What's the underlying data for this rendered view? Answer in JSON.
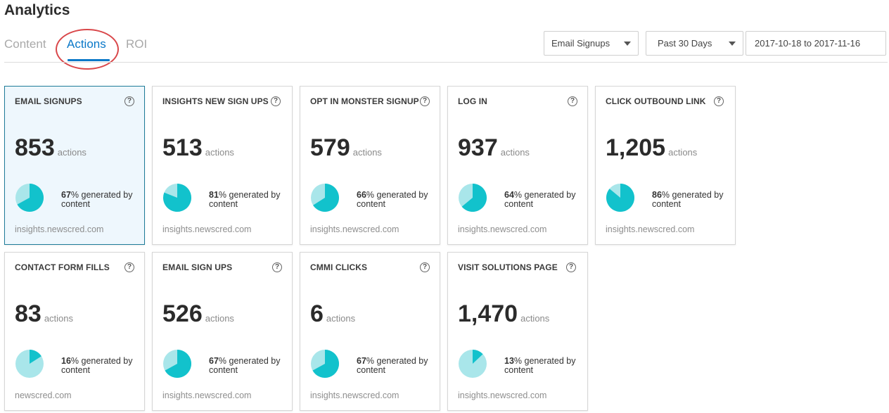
{
  "page_title": "Analytics",
  "tabs": [
    {
      "label": "Content",
      "active": false
    },
    {
      "label": "Actions",
      "active": true
    },
    {
      "label": "ROI",
      "active": false
    }
  ],
  "filters": {
    "action_select": "Email Signups",
    "range_select": "Past 30 Days",
    "date_range": "2017-10-18 to 2017-11-16"
  },
  "colors": {
    "accent_blue": "#0a78c8",
    "pie_primary": "#12c2cc",
    "pie_secondary": "#a9e6ea",
    "annotation_red": "#d9474a"
  },
  "cards": [
    {
      "title": "EMAIL SIGNUPS",
      "value": "853",
      "unit": "actions",
      "pct": "67",
      "pct_text": "% generated by content",
      "pct_fraction": 0.67,
      "domain": "insights.newscred.com",
      "active": true
    },
    {
      "title": "INSIGHTS NEW SIGN UPS",
      "value": "513",
      "unit": "actions",
      "pct": "81",
      "pct_text": "% generated by content",
      "pct_fraction": 0.81,
      "domain": "insights.newscred.com",
      "active": false
    },
    {
      "title": "OPT IN MONSTER SIGNUP",
      "value": "579",
      "unit": "actions",
      "pct": "66",
      "pct_text": "% generated by content",
      "pct_fraction": 0.66,
      "domain": "insights.newscred.com",
      "active": false
    },
    {
      "title": "LOG IN",
      "value": "937",
      "unit": "actions",
      "pct": "64",
      "pct_text": "% generated by content",
      "pct_fraction": 0.64,
      "domain": "insights.newscred.com",
      "active": false
    },
    {
      "title": "CLICK OUTBOUND LINK",
      "value": "1,205",
      "unit": "actions",
      "pct": "86",
      "pct_text": "% generated by content",
      "pct_fraction": 0.86,
      "domain": "insights.newscred.com",
      "active": false
    },
    {
      "title": "CONTACT FORM FILLS",
      "value": "83",
      "unit": "actions",
      "pct": "16",
      "pct_text": "% generated by content",
      "pct_fraction": 0.16,
      "domain": "newscred.com",
      "active": false
    },
    {
      "title": "EMAIL SIGN UPS",
      "value": "526",
      "unit": "actions",
      "pct": "67",
      "pct_text": "% generated by content",
      "pct_fraction": 0.67,
      "domain": "insights.newscred.com",
      "active": false
    },
    {
      "title": "CMMI CLICKS",
      "value": "6",
      "unit": "actions",
      "pct": "67",
      "pct_text": "% generated by content",
      "pct_fraction": 0.67,
      "domain": "insights.newscred.com",
      "active": false
    },
    {
      "title": "VISIT SOLUTIONS PAGE",
      "value": "1,470",
      "unit": "actions",
      "pct": "13",
      "pct_text": "% generated by content",
      "pct_fraction": 0.13,
      "domain": "insights.newscred.com",
      "active": false
    }
  ]
}
